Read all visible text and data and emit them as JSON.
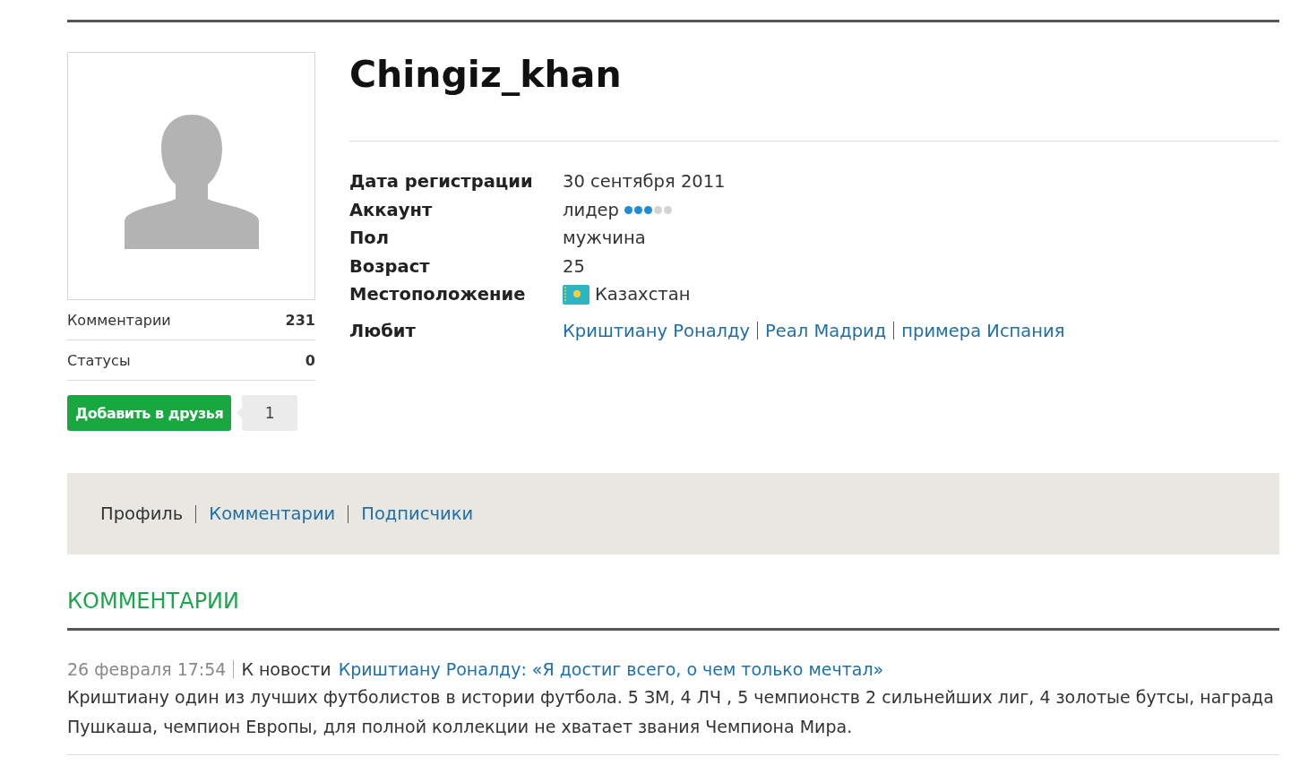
{
  "profile": {
    "username": "Chingiz_khan",
    "stats": [
      {
        "label": "Комментарии",
        "value": "231"
      },
      {
        "label": "Статусы",
        "value": "0"
      }
    ],
    "add_friend_button": "Добавить в друзья",
    "friend_count": "1",
    "info": [
      {
        "kind": "text",
        "label": "Дата регистрации",
        "value": "30 сентября 2011"
      },
      {
        "kind": "rating",
        "label": "Аккаунт",
        "value": "лидер",
        "stars": 3
      },
      {
        "kind": "text",
        "label": "Пол",
        "value": "мужчина"
      },
      {
        "kind": "text",
        "label": "Возраст",
        "value": "25"
      },
      {
        "kind": "flag",
        "label": "Местоположение",
        "value": "Казахстан"
      }
    ],
    "likes": {
      "label": "Любит",
      "items": [
        "Криштиану Роналду",
        "Реал Мадрид",
        "примера Испания"
      ]
    }
  },
  "tabs": [
    {
      "label": "Профиль",
      "selected": true
    },
    {
      "label": "Комментарии",
      "selected": false
    },
    {
      "label": "Подписчики",
      "selected": false
    }
  ],
  "comments_heading": "КОММЕНТАРИИ",
  "comments": [
    {
      "date": "26 февраля 17:54",
      "prefix": "К новости",
      "news_link": "Криштиану Роналду: «Я достиг всего, о чем только мечтал»",
      "text": "Криштиану один из лучших футболистов в истории футбола. 5 ЗМ, 4 ЛЧ , 5 чемпионств 2 сильнейших лиг, 4 золотые бутсы, награда Пушкаша, чемпион Европы, для полной коллекции не хватает звания Чемпиона Мира."
    }
  ]
}
